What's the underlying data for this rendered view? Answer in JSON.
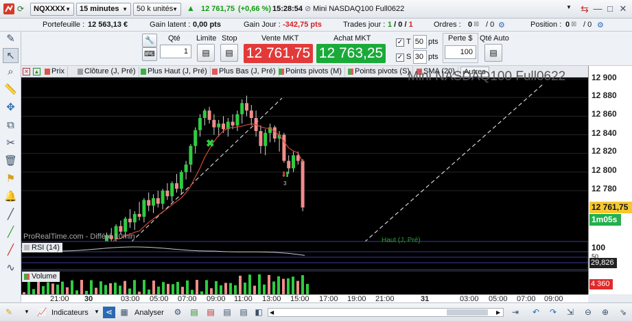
{
  "topbar": {
    "symbol": "NQXXXX",
    "interval": "15 minutes",
    "units": "50 k unités",
    "last_price": "12 761,75",
    "change": "(+0,66 %)",
    "time": "15:28:54",
    "instrument_name": "Mini NASDAQ100 Full0622"
  },
  "inforow": {
    "portfolio_label": "Portefeuille :",
    "portfolio_value": "12 563,13 €",
    "latent_label": "Gain latent :",
    "latent_value": "0,00 pts",
    "day_gain_label": "Gain Jour :",
    "day_gain_value": "-342,75 pts",
    "trades_label": "Trades jour :",
    "trades_a": "1",
    "trades_b": "0",
    "trades_c": "1",
    "orders_label": "Ordres :",
    "orders_value": "0",
    "orders_total": "0",
    "position_label": "Position :",
    "position_value": "0",
    "position_total": "0"
  },
  "order": {
    "qty_label": "Qté",
    "qty_value": "1",
    "limit_label": "Limite",
    "stop_label": "Stop",
    "sell_label": "Vente MKT",
    "sell_price": "12 761,75",
    "buy_label": "Achat MKT",
    "buy_price": "12 763,25",
    "t_label": "T",
    "t_value": "50",
    "t_unit": "pts",
    "s_label": "S",
    "s_value": "30",
    "s_unit": "pts",
    "loss_label": "Perte $",
    "loss_value": "100",
    "auto_qty_label": "Qté Auto"
  },
  "legend": {
    "items": [
      {
        "label": "Prix",
        "color": "#d9534f"
      },
      {
        "label": "Clôture (J, Pré)",
        "color": "#9e9e9e"
      },
      {
        "label": "Plus Haut (J, Pré)",
        "color": "#3cb043"
      },
      {
        "label": "Plus Bas (J, Pré)",
        "color": "#e05a5a"
      },
      {
        "label": "Points pivots (M)",
        "color": "#3cb043"
      },
      {
        "label": "Points pivots (S)",
        "color": "#3cb043"
      },
      {
        "label": "SMA (20)",
        "color": "#e05a5a"
      },
      {
        "label": "Autres",
        "color": ""
      }
    ],
    "watermark": "Mini NASDAQ100 Full0622"
  },
  "chart_data": {
    "type": "candlestick",
    "source_text": "ProRealTime.com - Différé 10min",
    "high_label": "Haut (J, Pré)",
    "price_ticks": [
      "12 900",
      "12 880",
      "12 860",
      "12 840",
      "12 820",
      "12 800",
      "12 780"
    ],
    "current_price": "12 761,75",
    "countdown": "1m05s",
    "rsi_label": "RSI (14)",
    "rsi_scale_top": "100",
    "rsi_scale_mid": "50",
    "rsi_value": "29,826",
    "volume_label": "Volume",
    "volume_value": "4 360",
    "time_ticks": [
      "21:00",
      "30",
      "03:00",
      "05:00",
      "07:00",
      "09:00",
      "11:00",
      "13:00",
      "15:00",
      "17:00",
      "19:00",
      "21:00",
      "31",
      "03:00",
      "05:00",
      "07:00",
      "09:00"
    ],
    "marker_label": "3",
    "candles": [
      [
        12722,
        12735,
        12715,
        12732
      ],
      [
        12732,
        12740,
        12726,
        12728
      ],
      [
        12728,
        12744,
        12724,
        12742
      ],
      [
        12742,
        12748,
        12733,
        12736
      ],
      [
        12736,
        12752,
        12730,
        12750
      ],
      [
        12750,
        12760,
        12740,
        12746
      ],
      [
        12746,
        12758,
        12738,
        12755
      ],
      [
        12755,
        12768,
        12748,
        12752
      ],
      [
        12752,
        12772,
        12746,
        12770
      ],
      [
        12770,
        12778,
        12758,
        12764
      ],
      [
        12764,
        12776,
        12756,
        12772
      ],
      [
        12772,
        12780,
        12762,
        12766
      ],
      [
        12766,
        12782,
        12760,
        12780
      ],
      [
        12780,
        12788,
        12770,
        12774
      ],
      [
        12774,
        12790,
        12768,
        12788
      ],
      [
        12788,
        12798,
        12778,
        12782
      ],
      [
        12782,
        12802,
        12776,
        12800
      ],
      [
        12800,
        12812,
        12792,
        12808
      ],
      [
        12808,
        12830,
        12800,
        12828
      ],
      [
        12828,
        12848,
        12820,
        12845
      ],
      [
        12845,
        12862,
        12838,
        12858
      ],
      [
        12858,
        12868,
        12850,
        12866
      ],
      [
        12866,
        12870,
        12852,
        12856
      ],
      [
        12856,
        12862,
        12840,
        12848
      ],
      [
        12848,
        12856,
        12838,
        12852
      ],
      [
        12852,
        12860,
        12842,
        12846
      ],
      [
        12846,
        12858,
        12838,
        12854
      ],
      [
        12854,
        12862,
        12846,
        12850
      ],
      [
        12850,
        12866,
        12844,
        12862
      ],
      [
        12862,
        12878,
        12852,
        12874
      ],
      [
        12874,
        12882,
        12860,
        12866
      ],
      [
        12866,
        12872,
        12850,
        12858
      ],
      [
        12858,
        12866,
        12838,
        12844
      ],
      [
        12844,
        12850,
        12820,
        12828
      ],
      [
        12828,
        12846,
        12818,
        12842
      ],
      [
        12842,
        12852,
        12832,
        12848
      ],
      [
        12848,
        12850,
        12832,
        12836
      ],
      [
        12836,
        12844,
        12822,
        12840
      ],
      [
        12840,
        12842,
        12810,
        12812
      ],
      [
        12812,
        12818,
        12798,
        12804
      ],
      [
        12804,
        12822,
        12800,
        12818
      ],
      [
        12818,
        12822,
        12808,
        12812
      ],
      [
        12812,
        12814,
        12758,
        12762
      ]
    ]
  },
  "bottombar": {
    "indicators_label": "Indicateurs",
    "analyze_label": "Analyser"
  }
}
